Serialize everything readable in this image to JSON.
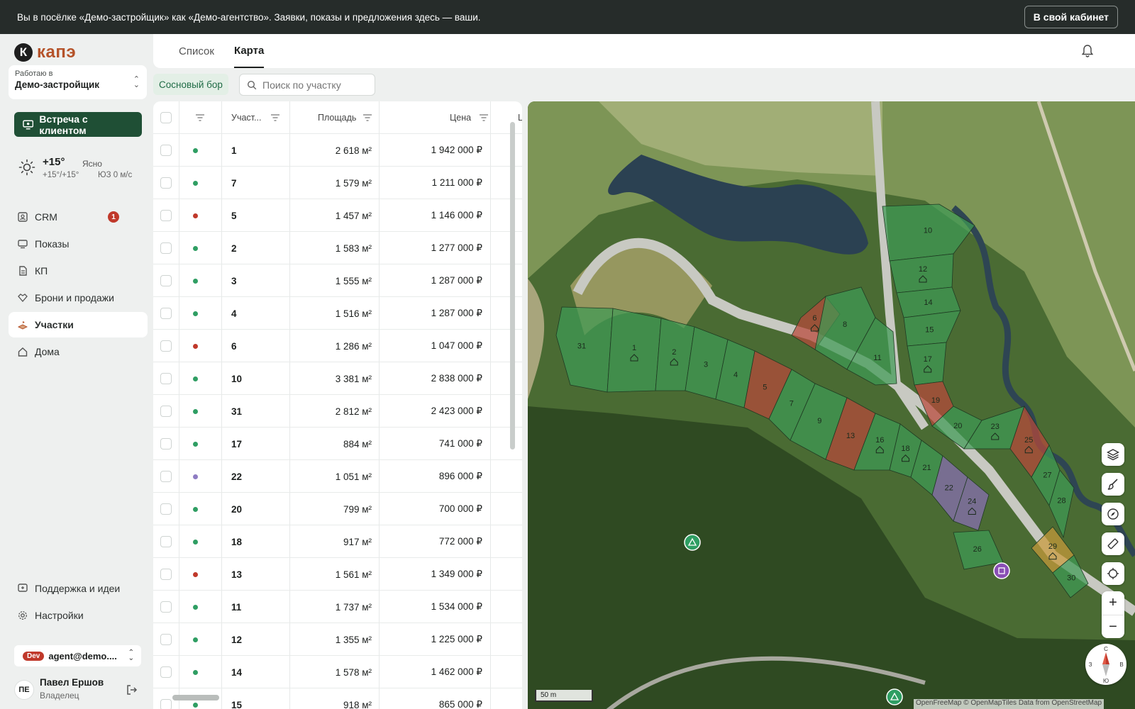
{
  "banner": {
    "text": "Вы в посёлке «Демо-застройщик» как «Демо-агентство». Заявки, показы и предложения здесь — ваши.",
    "button": "В свой кабинет"
  },
  "logo": {
    "mark": "К",
    "text": "капэ"
  },
  "workspace": {
    "label": "Работаю в",
    "value": "Демо-застройщик"
  },
  "meet_button": "Встреча с клиентом",
  "weather": {
    "temp": "+15°",
    "desc": "Ясно",
    "range": "+15°/+15°",
    "wind": "ЮЗ 0 м/с",
    "icon": "sun-icon"
  },
  "nav": [
    {
      "label": "CRM",
      "icon": "crm-icon",
      "badge": "1"
    },
    {
      "label": "Показы",
      "icon": "monitor-icon"
    },
    {
      "label": "КП",
      "icon": "document-icon"
    },
    {
      "label": "Брони и продажи",
      "icon": "handshake-icon"
    },
    {
      "label": "Участки",
      "icon": "plot-icon",
      "active": true
    },
    {
      "label": "Дома",
      "icon": "house-icon"
    }
  ],
  "nav_bottom": [
    {
      "label": "Поддержка и идеи",
      "icon": "support-icon"
    },
    {
      "label": "Настройки",
      "icon": "gear-icon"
    }
  ],
  "account": {
    "badge": "Dev",
    "email": "agent@demo...."
  },
  "user": {
    "initials": "ПЕ",
    "name": "Павел Ершов",
    "role": "Владелец"
  },
  "tabs": [
    {
      "label": "Список",
      "active": false
    },
    {
      "label": "Карта",
      "active": true
    }
  ],
  "filter_chip": "Сосновый бор",
  "search": {
    "placeholder": "Поиск по участку"
  },
  "table": {
    "columns": [
      "Участ...",
      "Площадь",
      "Цена",
      "Ц"
    ],
    "status_colors": {
      "free": "#2f9e63",
      "sold": "#c0392b",
      "reserved": "#8e7cc3"
    },
    "rows": [
      {
        "id": "1",
        "status": "free",
        "area": "2 618 м²",
        "price": "1 942 000 ₽"
      },
      {
        "id": "7",
        "status": "free",
        "area": "1 579 м²",
        "price": "1 211 000 ₽"
      },
      {
        "id": "5",
        "status": "sold",
        "area": "1 457 м²",
        "price": "1 146 000 ₽"
      },
      {
        "id": "2",
        "status": "free",
        "area": "1 583 м²",
        "price": "1 277 000 ₽"
      },
      {
        "id": "3",
        "status": "free",
        "area": "1 555 м²",
        "price": "1 287 000 ₽"
      },
      {
        "id": "4",
        "status": "free",
        "area": "1 516 м²",
        "price": "1 287 000 ₽"
      },
      {
        "id": "6",
        "status": "sold",
        "area": "1 286 м²",
        "price": "1 047 000 ₽"
      },
      {
        "id": "10",
        "status": "free",
        "area": "3 381 м²",
        "price": "2 838 000 ₽"
      },
      {
        "id": "31",
        "status": "free",
        "area": "2 812 м²",
        "price": "2 423 000 ₽"
      },
      {
        "id": "17",
        "status": "free",
        "area": "884 м²",
        "price": "741 000 ₽"
      },
      {
        "id": "22",
        "status": "reserved",
        "area": "1 051 м²",
        "price": "896 000 ₽"
      },
      {
        "id": "20",
        "status": "free",
        "area": "799 м²",
        "price": "700 000 ₽"
      },
      {
        "id": "18",
        "status": "free",
        "area": "917 м²",
        "price": "772 000 ₽"
      },
      {
        "id": "13",
        "status": "sold",
        "area": "1 561 м²",
        "price": "1 349 000 ₽"
      },
      {
        "id": "11",
        "status": "free",
        "area": "1 737 м²",
        "price": "1 534 000 ₽"
      },
      {
        "id": "12",
        "status": "free",
        "area": "1 355 м²",
        "price": "1 225 000 ₽"
      },
      {
        "id": "14",
        "status": "free",
        "area": "1 578 м²",
        "price": "1 462 000 ₽"
      },
      {
        "id": "15",
        "status": "free",
        "area": "918 м²",
        "price": "865 000 ₽"
      }
    ]
  },
  "map": {
    "plots": [
      {
        "id": "31",
        "status": "free"
      },
      {
        "id": "1",
        "status": "free",
        "house": true
      },
      {
        "id": "2",
        "status": "free",
        "house": true
      },
      {
        "id": "3",
        "status": "free"
      },
      {
        "id": "4",
        "status": "free"
      },
      {
        "id": "5",
        "status": "sold"
      },
      {
        "id": "6",
        "status": "sold",
        "house": true
      },
      {
        "id": "7",
        "status": "free"
      },
      {
        "id": "8",
        "status": "free"
      },
      {
        "id": "9",
        "status": "free"
      },
      {
        "id": "10",
        "status": "free"
      },
      {
        "id": "11",
        "status": "free"
      },
      {
        "id": "12",
        "status": "free",
        "house": true
      },
      {
        "id": "13",
        "status": "sold"
      },
      {
        "id": "14",
        "status": "free"
      },
      {
        "id": "15",
        "status": "free"
      },
      {
        "id": "16",
        "status": "free",
        "house": true
      },
      {
        "id": "17",
        "status": "free",
        "house": true
      },
      {
        "id": "18",
        "status": "free",
        "house": true
      },
      {
        "id": "19",
        "status": "sold"
      },
      {
        "id": "20",
        "status": "free"
      },
      {
        "id": "21",
        "status": "free"
      },
      {
        "id": "22",
        "status": "reserved"
      },
      {
        "id": "23",
        "status": "free",
        "house": true
      },
      {
        "id": "24",
        "status": "reserved",
        "house": true
      },
      {
        "id": "25",
        "status": "sold",
        "house": true
      },
      {
        "id": "26",
        "status": "free"
      },
      {
        "id": "27",
        "status": "free"
      },
      {
        "id": "28",
        "status": "free"
      },
      {
        "id": "29",
        "status": "booked",
        "house": true
      },
      {
        "id": "30",
        "status": "free"
      }
    ],
    "plot_colors": {
      "free": "#3f9a55",
      "sold": "#b8483a",
      "reserved": "#8a6fb5",
      "booked": "#c99a3a"
    },
    "controls": [
      "layers-icon",
      "brush-icon",
      "compass-nav-icon",
      "ruler-icon",
      "locate-icon"
    ],
    "zoom_in": "+",
    "zoom_out": "−",
    "compass": {
      "n": "С",
      "s": "Ю",
      "e": "В",
      "w": "З"
    },
    "scale": "50 m",
    "attribution": "OpenFreeMap © OpenMapTiles Data from OpenStreetMap"
  }
}
